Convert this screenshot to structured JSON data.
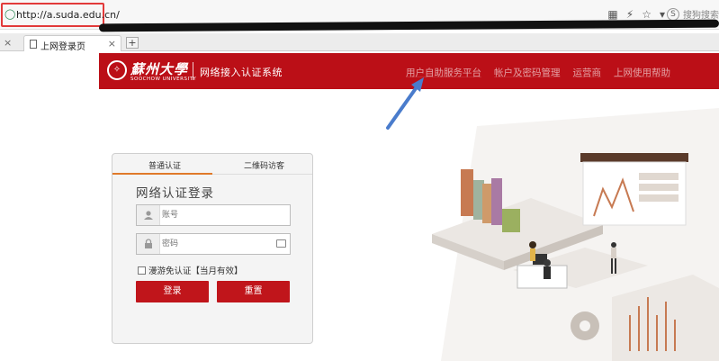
{
  "browser": {
    "url": "http://a.suda.edu.cn/",
    "search_placeholder": "搜狗搜索",
    "tab_title": "上网登录页"
  },
  "header": {
    "logo_cn": "蘇州大學",
    "logo_en": "SOOCHOW UNIVERSITY",
    "system_title": "网络接入认证系统",
    "nav": [
      "用户自助服务平台",
      "帐户及密码管理",
      "运营商",
      "上网使用帮助"
    ]
  },
  "login": {
    "tab_normal": "普通认证",
    "tab_qr": "二维码访客",
    "title": "网络认证登录",
    "username_placeholder": "账号",
    "password_placeholder": "密码",
    "roam_label": "漫游免认证【当月有效】",
    "login_button": "登录",
    "reset_button": "重置"
  },
  "colors": {
    "brand_red": "#bb0f17",
    "button_red": "#c0151b",
    "tab_accent": "#e07a2a",
    "arrow": "#4a7ccc"
  }
}
